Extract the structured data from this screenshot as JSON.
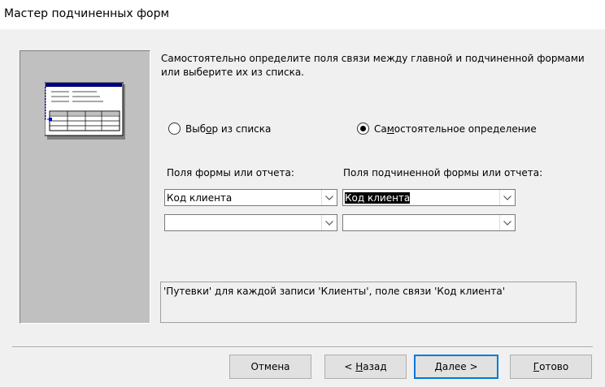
{
  "window": {
    "title": "Мастер подчиненных форм"
  },
  "description": "Самостоятельно определите поля связи между главной и подчиненной формами или выберите их из списка.",
  "options": [
    {
      "label_pre": "Выб",
      "label_ul": "о",
      "label_post": "р из списка",
      "selected": false
    },
    {
      "label_pre": "Са",
      "label_ul": "м",
      "label_post": "остоятельное определение",
      "selected": true
    }
  ],
  "fields": {
    "main_label": "Поля формы или отчета:",
    "sub_label": "Поля подчиненной формы или отчета:",
    "main_row1": "Код клиента",
    "main_row2": "",
    "sub_row1": "Код клиента",
    "sub_row2": ""
  },
  "status_text": "'Путевки' для каждой записи 'Клиенты', поле связи 'Код клиента'",
  "buttons": {
    "cancel": "Отмена",
    "back_pre": "< ",
    "back_ul": "Н",
    "back_post": "азад",
    "next_ul": "Д",
    "next_post": "алее >",
    "finish_ul": "Г",
    "finish_post": "отово"
  },
  "colors": {
    "accent": "#0078d7",
    "panel": "#c0c0c0",
    "illustration_header": "#000080"
  }
}
